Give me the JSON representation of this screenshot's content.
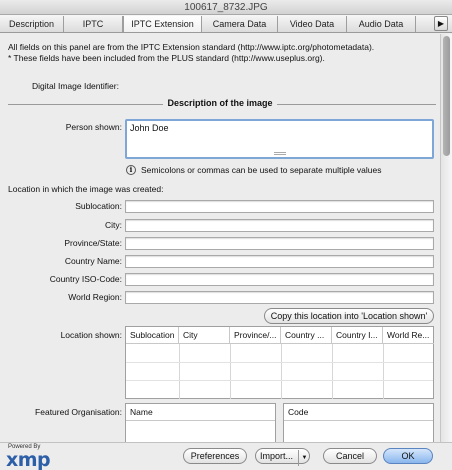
{
  "window": {
    "title": "100617_8732.JPG"
  },
  "tabs": [
    {
      "label": "Description"
    },
    {
      "label": "IPTC"
    },
    {
      "label": "IPTC Extension"
    },
    {
      "label": "Camera Data"
    },
    {
      "label": "Video Data"
    },
    {
      "label": "Audio Data"
    }
  ],
  "tab_overflow_icon": "triangle-right-icon",
  "notes": {
    "line1": "All fields on this panel are from the IPTC Extension standard (http://www.iptc.org/photometadata).",
    "line2": "* These fields have been included from the PLUS standard (http://www.useplus.org)."
  },
  "digital_image_identifier": {
    "label": "Digital Image Identifier:"
  },
  "description_section": {
    "title": "Description of the image"
  },
  "person_shown": {
    "label": "Person shown:",
    "value": "John Doe"
  },
  "hint": {
    "icon": "info-icon",
    "text": "Semicolons or commas can be used to separate multiple values"
  },
  "location_created": {
    "heading": "Location in which the image was created:",
    "fields": [
      {
        "label": "Sublocation:",
        "value": ""
      },
      {
        "label": "City:",
        "value": ""
      },
      {
        "label": "Province/State:",
        "value": ""
      },
      {
        "label": "Country Name:",
        "value": ""
      },
      {
        "label": "Country ISO-Code:",
        "value": ""
      },
      {
        "label": "World Region:",
        "value": ""
      }
    ],
    "copy_button": "Copy this location into 'Location shown'"
  },
  "location_shown": {
    "label": "Location shown:",
    "columns": [
      "Sublocation",
      "City",
      "Province/...",
      "Country ...",
      "Country I...",
      "World Re..."
    ]
  },
  "featured_org": {
    "label": "Featured Organisation:",
    "name_col": "Name",
    "code_col": "Code"
  },
  "footer": {
    "powered_by": "Powered By",
    "logo": "xmp",
    "preferences": "Preferences",
    "import": "Import...",
    "cancel": "Cancel",
    "ok": "OK"
  },
  "colors": {
    "ok_button": "#89b6ee",
    "focus_ring": "#7ea6d6",
    "xmp_logo": "#2c5fa7"
  }
}
